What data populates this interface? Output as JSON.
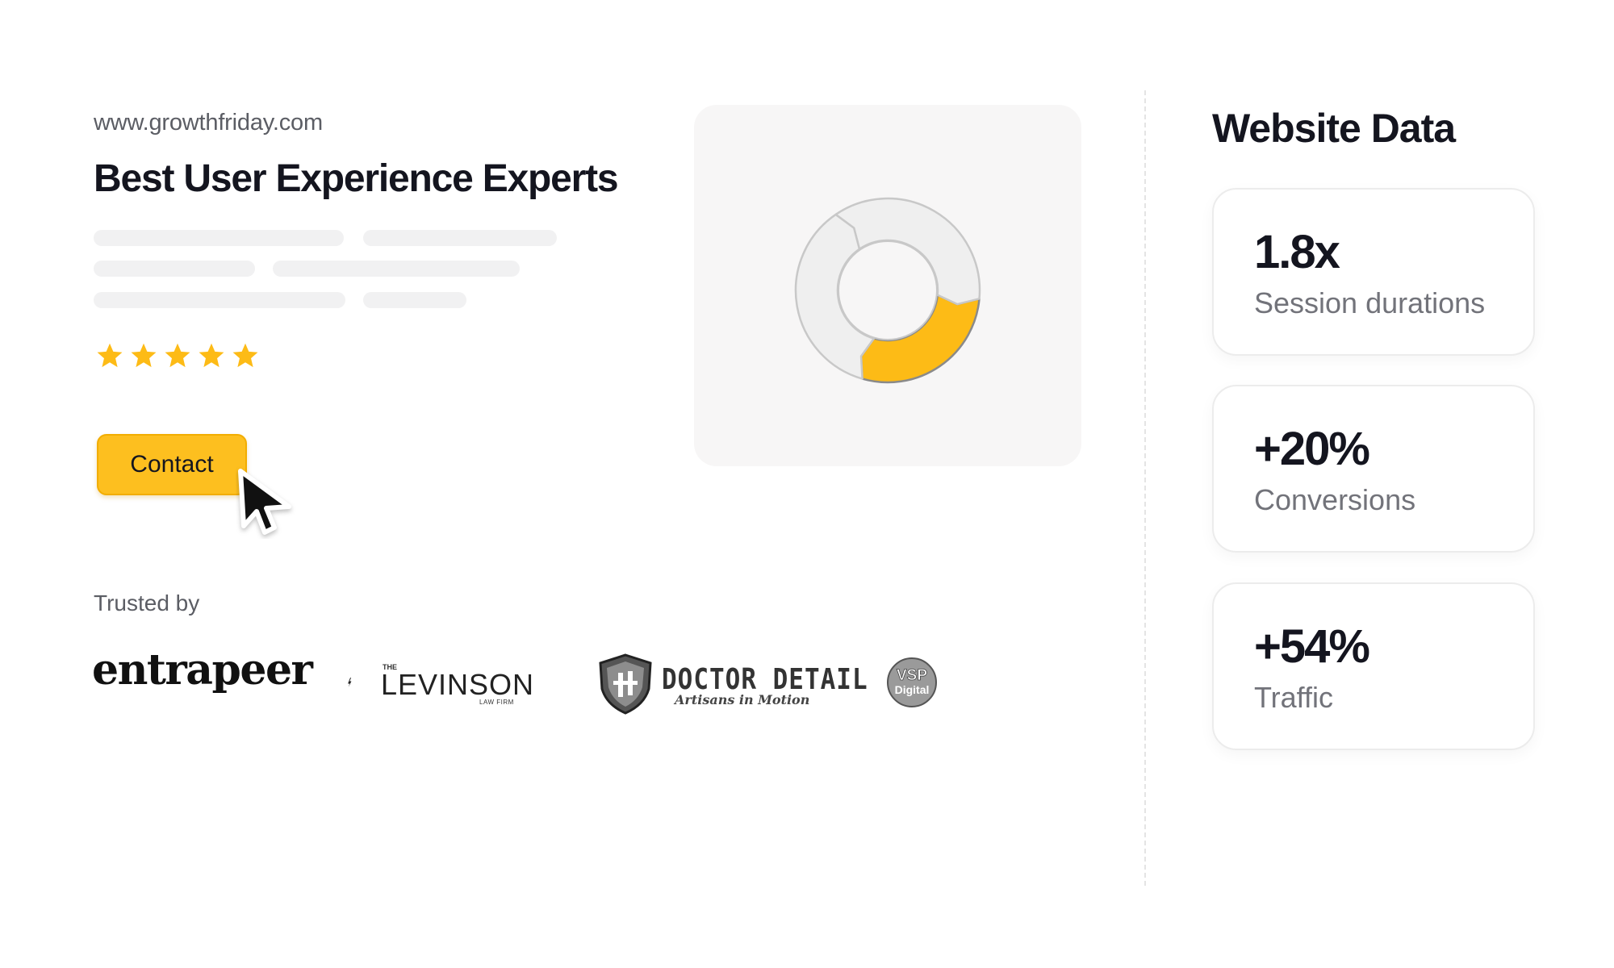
{
  "site": {
    "url": "www.growthfriday.com",
    "headline": "Best User Experience Experts",
    "rating": 5,
    "contact_label": "Contact"
  },
  "trusted": {
    "label": "Trusted by",
    "logos": [
      {
        "name": "entrapeer",
        "text": "entrapeer"
      },
      {
        "name": "levinson",
        "prefix": "THE",
        "text": "LEVINSON",
        "subtext": "LAW FIRM"
      },
      {
        "name": "doctor-detail",
        "text": "DOCTOR DETAIL",
        "subtext": "Artisans in Motion"
      },
      {
        "name": "vsp-digital",
        "text": "VSP Digital"
      }
    ]
  },
  "chart_data": {
    "type": "pie",
    "style": "donut",
    "segments": [
      {
        "value": 28,
        "color": "#fdbb16",
        "highlighted": true
      },
      {
        "value": 36,
        "color": "#efefef",
        "highlighted": false
      },
      {
        "value": 36,
        "color": "#efefef",
        "highlighted": false
      }
    ]
  },
  "panel": {
    "title": "Website Data",
    "stats": [
      {
        "value": "1.8x",
        "label": "Session durations"
      },
      {
        "value": "+20%",
        "label": "Conversions"
      },
      {
        "value": "+54%",
        "label": "Traffic"
      }
    ]
  },
  "colors": {
    "accent": "#fdbf1f",
    "star": "#fdbb16",
    "text": "#14151f",
    "muted": "#72737a",
    "skeleton": "#f1f1f2"
  },
  "icons": {
    "rating": "star-icon",
    "pointer": "cursor-arrow-icon"
  }
}
